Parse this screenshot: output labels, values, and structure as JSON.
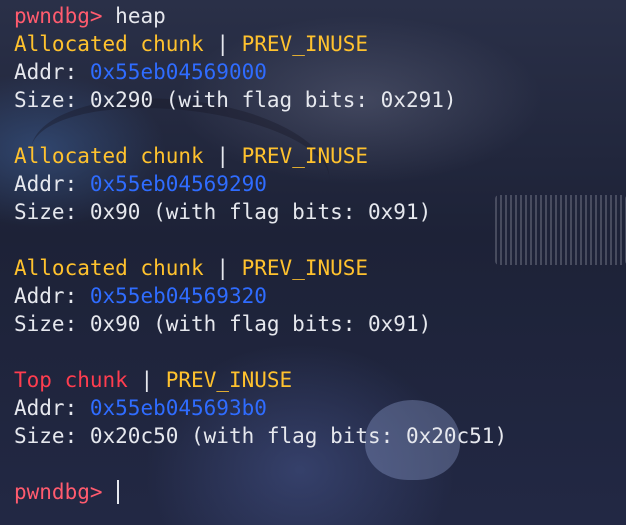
{
  "prompt": "pwndbg>",
  "command": "heap",
  "separator": "|",
  "addr_label": "Addr:",
  "size_label": "Size:",
  "chunks": [
    {
      "type": "Allocated chunk",
      "flag": "PREV_INUSE",
      "addr": "0x55eb04569000",
      "size": "0x290 (with flag bits: 0x291)"
    },
    {
      "type": "Allocated chunk",
      "flag": "PREV_INUSE",
      "addr": "0x55eb04569290",
      "size": "0x90 (with flag bits: 0x91)"
    },
    {
      "type": "Allocated chunk",
      "flag": "PREV_INUSE",
      "addr": "0x55eb04569320",
      "size": "0x90 (with flag bits: 0x91)"
    },
    {
      "type": "Top chunk",
      "flag": "PREV_INUSE",
      "addr": "0x55eb045693b0",
      "size": "0x20c50 (with flag bits: 0x20c51)"
    }
  ],
  "colors": {
    "prompt": "#ff5b6e",
    "allocated": "#ffc22e",
    "top": "#ff3d4f",
    "address": "#2f6cff",
    "text": "#e6e8ee"
  }
}
